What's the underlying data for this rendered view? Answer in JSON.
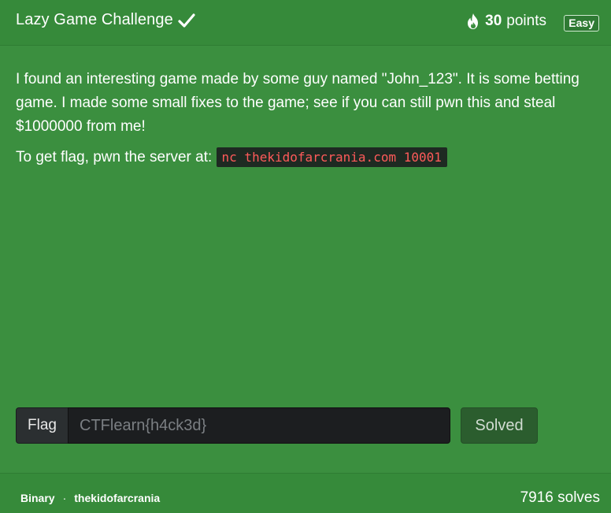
{
  "challenge": {
    "title": "Lazy Game Challenge",
    "points_value": "30",
    "points_label": "points",
    "difficulty": "Easy"
  },
  "description": {
    "text": "I found an interesting game made by some guy named \"John_123\". It is some betting game. I made some small fixes to the game; see if you can still pwn this and steal $1000000 from me!",
    "server_prefix": "To get flag, pwn the server at:",
    "server_command": "nc thekidofarcrania.com 10001"
  },
  "flag_form": {
    "label": "Flag",
    "placeholder": "CTFlearn{h4ck3d}",
    "value": "",
    "submit_label": "Solved"
  },
  "footer": {
    "category": "Binary",
    "separator": "·",
    "author": "thekidofarcrania",
    "solves": "7916 solves"
  },
  "icons": {
    "title_status": "check-icon",
    "points": "fire-icon"
  },
  "colors": {
    "card_background": "#3b8f3f",
    "code_text": "#ff5a5a",
    "code_background": "#1e2a22"
  }
}
